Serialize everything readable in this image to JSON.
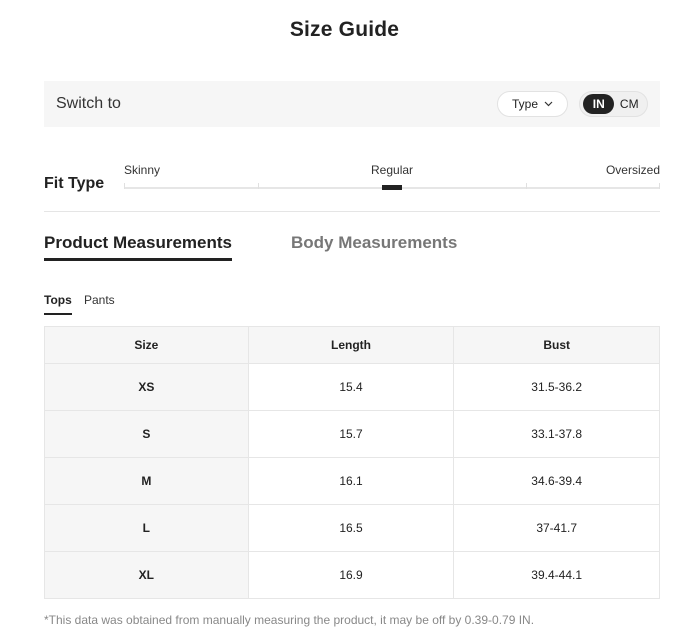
{
  "title": "Size Guide",
  "switch": {
    "label": "Switch to",
    "type_label": "Type",
    "units": {
      "in": "IN",
      "cm": "CM",
      "selected": "IN"
    }
  },
  "fit": {
    "label": "Fit Type",
    "options": [
      "Skinny",
      "Regular",
      "Oversized"
    ],
    "selected": "Regular"
  },
  "tabs": {
    "product": "Product Measurements",
    "body": "Body Measurements",
    "active": "product"
  },
  "subtabs": {
    "tops": "Tops",
    "pants": "Pants",
    "active": "tops"
  },
  "table": {
    "headers": [
      "Size",
      "Length",
      "Bust"
    ],
    "rows": [
      [
        "XS",
        "15.4",
        "31.5-36.2"
      ],
      [
        "S",
        "15.7",
        "33.1-37.8"
      ],
      [
        "M",
        "16.1",
        "34.6-39.4"
      ],
      [
        "L",
        "16.5",
        "37-41.7"
      ],
      [
        "XL",
        "16.9",
        "39.4-44.1"
      ]
    ]
  },
  "note": "*This data was obtained from manually measuring the product, it may be off by 0.39-0.79 IN."
}
